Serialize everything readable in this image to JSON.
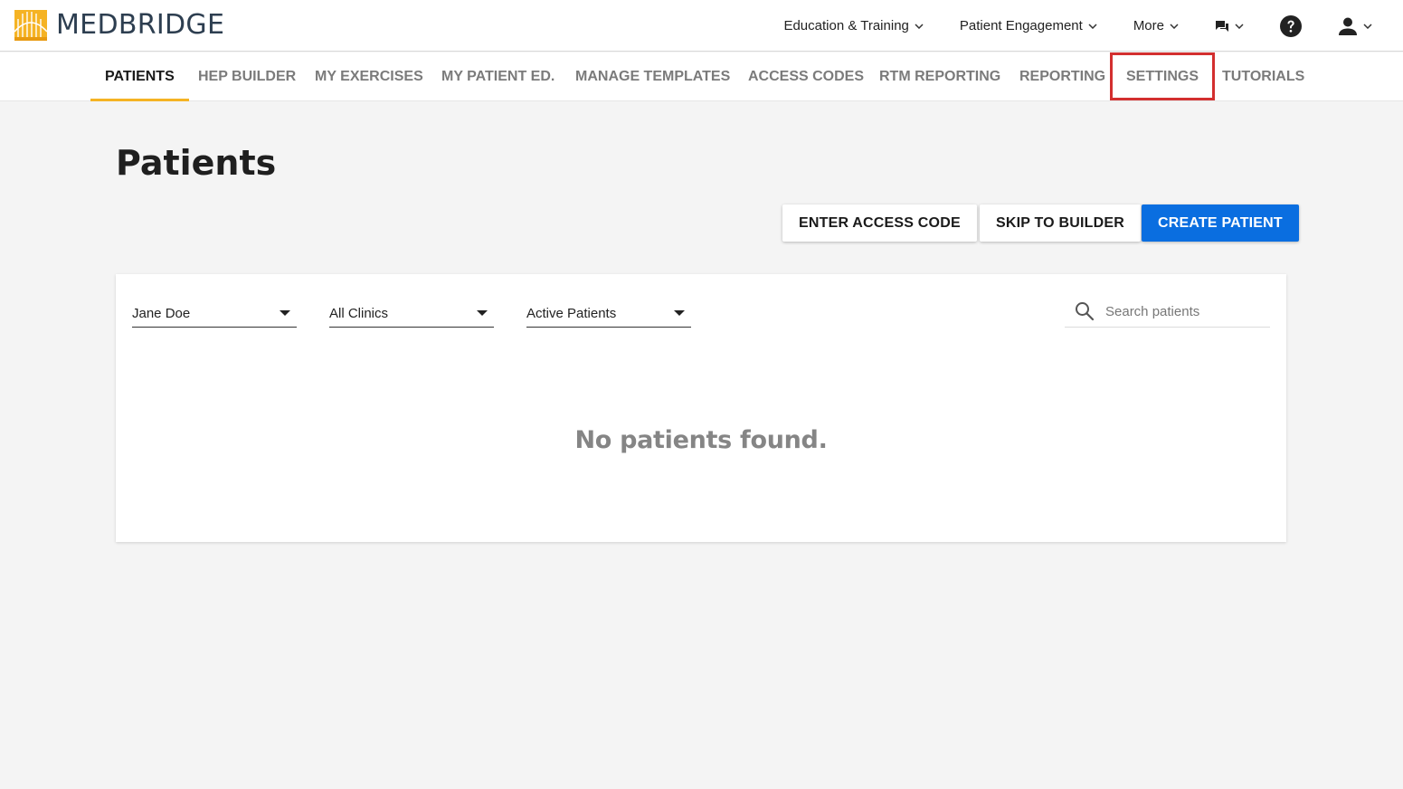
{
  "brand": {
    "name": "MEDBRIDGE",
    "accent": "#f5b324",
    "primary": "#0a6ee0",
    "highlight": "#d32f2f"
  },
  "top_nav": {
    "items": [
      {
        "label": "Education & Training"
      },
      {
        "label": "Patient Engagement"
      },
      {
        "label": "More"
      }
    ],
    "icons": [
      "chat-icon",
      "help-icon",
      "user-icon"
    ]
  },
  "tabs": [
    {
      "label": "PATIENTS",
      "active": true
    },
    {
      "label": "HEP BUILDER"
    },
    {
      "label": "MY EXERCISES"
    },
    {
      "label": "MY PATIENT ED."
    },
    {
      "label": "MANAGE TEMPLATES"
    },
    {
      "label": "ACCESS CODES"
    },
    {
      "label": "RTM REPORTING"
    },
    {
      "label": "REPORTING"
    },
    {
      "label": "SETTINGS",
      "highlighted": true
    },
    {
      "label": "TUTORIALS"
    }
  ],
  "page": {
    "title": "Patients",
    "buttons": {
      "enter_access_code": "ENTER ACCESS CODE",
      "skip_to_builder": "SKIP TO BUILDER",
      "create_patient": "CREATE PATIENT"
    }
  },
  "filters": {
    "provider": "Jane Doe",
    "clinic": "All Clinics",
    "status": "Active Patients",
    "search_placeholder": "Search patients"
  },
  "empty_state": "No patients found."
}
